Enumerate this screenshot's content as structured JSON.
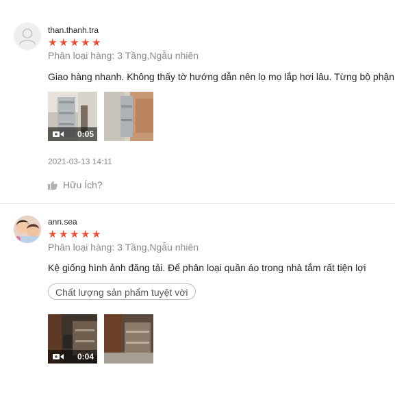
{
  "reviews": [
    {
      "username": "than.thanh.tra",
      "rating": 5,
      "variation": "Phân loại hàng: 3 Tầng,Ngẫu nhiên",
      "comment": "Giao hàng nhanh. Không thấy tờ hướng dẫn nên lọ mọ lắp hơi lâu. Từng bộ phận",
      "media": [
        {
          "type": "video",
          "duration": "0:05"
        },
        {
          "type": "image"
        }
      ],
      "timestamp": "2021-03-13 14:11",
      "helpful_label": "Hữu Ích?"
    },
    {
      "username": "ann.sea",
      "rating": 5,
      "variation": "Phân loại hàng: 3 Tầng,Ngẫu nhiên",
      "comment": "Kệ giống hình ảnh đăng tải. Để phân loại quần áo trong nhà tắm rất tiện lợi",
      "tag": "Chất lượng sản phẩm tuyệt vời",
      "media": [
        {
          "type": "video",
          "duration": "0:04"
        },
        {
          "type": "image"
        }
      ]
    }
  ],
  "colors": {
    "star": "#ee4d2d",
    "muted_text": "#8a8a8a",
    "divider": "#e8e8e8"
  },
  "icons": {
    "star": "star-icon",
    "video": "video-camera-icon",
    "thumbs_up": "thumbs-up-icon",
    "default_avatar": "user-icon"
  }
}
